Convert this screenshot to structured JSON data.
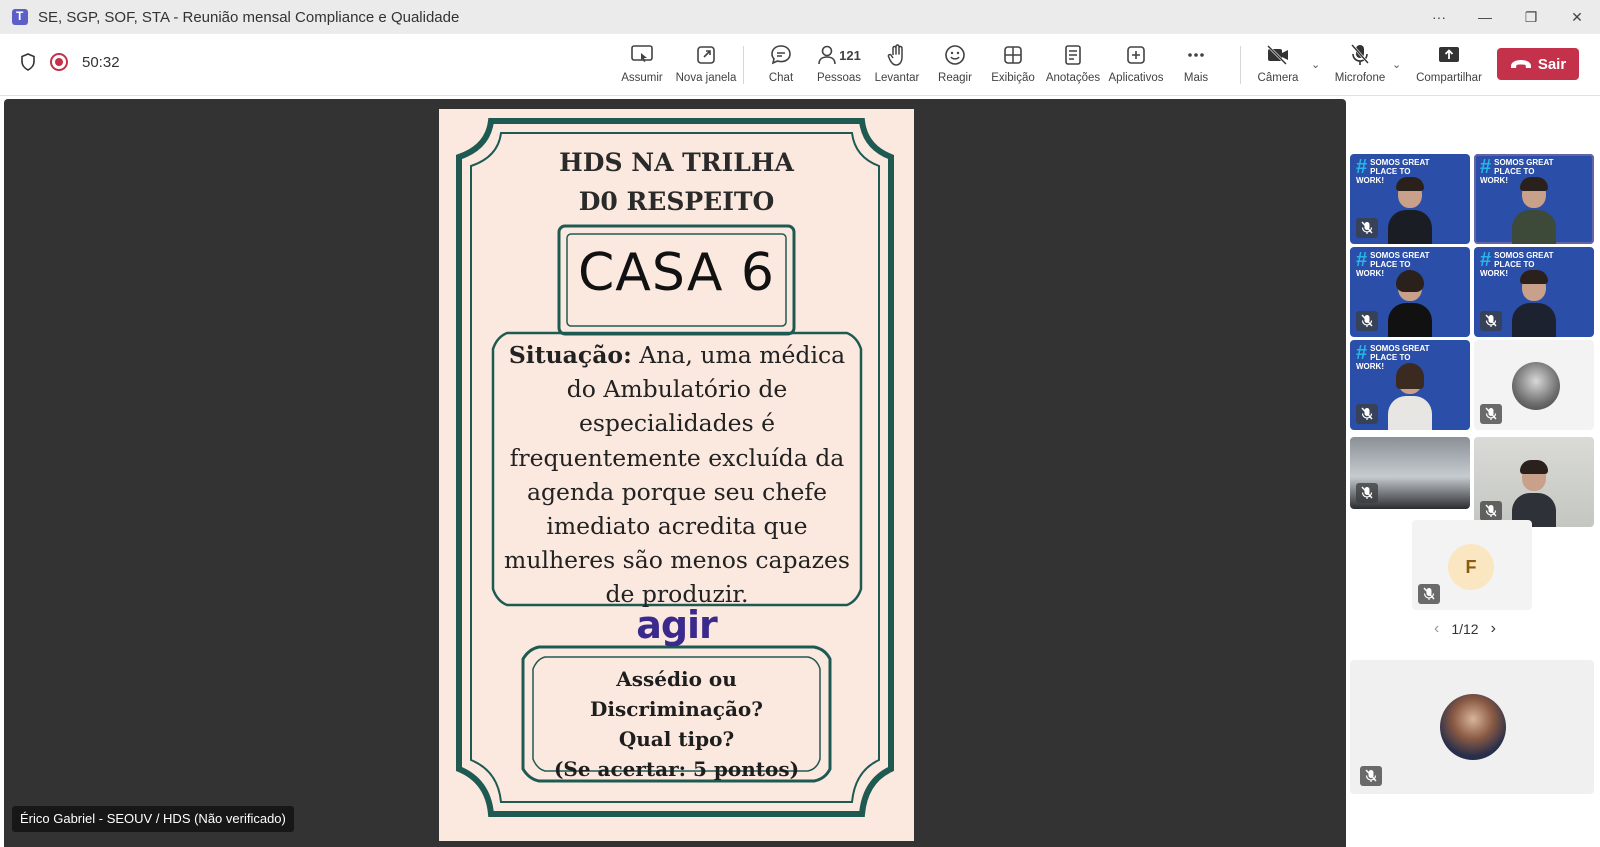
{
  "window": {
    "title": "SE, SGP, SOF, STA - Reunião mensal Compliance e Qualidade",
    "controls": [
      "···",
      "—",
      "❐",
      "✕"
    ]
  },
  "meeting": {
    "timer": "50:32",
    "toolbar": {
      "assumir": "Assumir",
      "nova_janela": "Nova janela",
      "chat": "Chat",
      "pessoas": "Pessoas",
      "people_count": "121",
      "levantar": "Levantar",
      "reagir": "Reagir",
      "exibicao": "Exibição",
      "anotacoes": "Anotações",
      "aplicativos": "Aplicativos",
      "mais": "Mais",
      "camera": "Câmera",
      "microfone": "Microfone",
      "compartilhar": "Compartilhar",
      "sair": "Sair"
    }
  },
  "slide": {
    "title_line1": "HDS NA TRILHA",
    "title_line2": "D0 RESPEITO",
    "casa": "CASA 6",
    "situacao_label": "Situação:",
    "situacao_text": "Ana, uma médica do Ambulatório de especialidades é frequentemente excluída da agenda porque seu chefe imediato acredita que mulheres são menos capazes de produzir.",
    "logo_text": "agir",
    "question_line1": "Assédio ou Discriminação?",
    "question_line2": "Qual tipo?",
    "question_line3": "(Se acertar: 5 pontos)",
    "border_color": "#1f5a52",
    "background_color": "#fbe9e0"
  },
  "presenter": {
    "label": "Érico Gabriel - SEOUV / HDS (Não verificado)"
  },
  "gallery": {
    "banner_text_line1": "SOMOS GREAT",
    "banner_text_line2": "PLACE TO WORK!",
    "initial": "F",
    "pager": "1/12"
  },
  "colors": {
    "accent": "#6264a7",
    "leave": "#c4314b",
    "stage": "#333333",
    "gptw_blue": "#2b4fa8"
  }
}
